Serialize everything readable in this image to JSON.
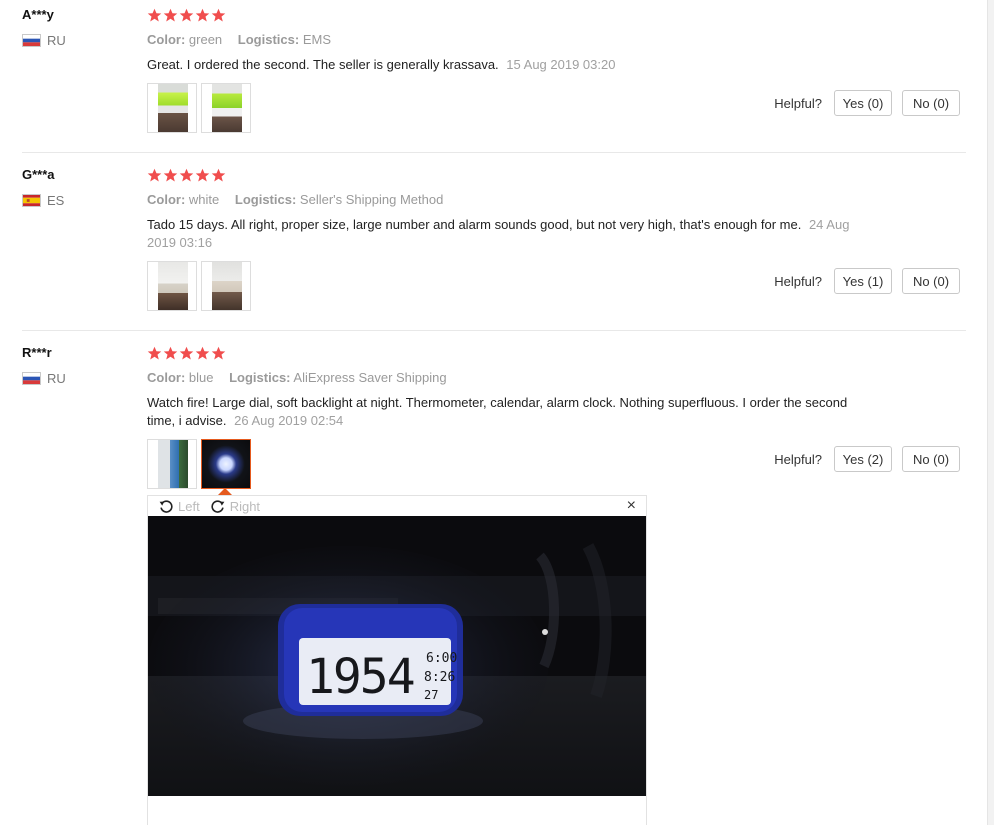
{
  "reviews": [
    {
      "user": "A***y",
      "country": "RU",
      "flag": "ru",
      "rating": 5,
      "color_label": "Color:",
      "color_value": "green",
      "logistics_label": "Logistics:",
      "logistics_value": "EMS",
      "text": "Great. I ordered the second. The seller is generally krassava.",
      "date": "15 Aug 2019 03:20",
      "thumbnails": [
        "photo-thumbnail",
        "photo-thumbnail"
      ],
      "helpful_label": "Helpful?",
      "yes_label": "Yes (0)",
      "no_label": "No (0)"
    },
    {
      "user": "G***a",
      "country": "ES",
      "flag": "es",
      "rating": 5,
      "color_label": "Color:",
      "color_value": "white",
      "logistics_label": "Logistics:",
      "logistics_value": "Seller's Shipping Method",
      "text": "Tado 15 days. All right, proper size, large number and alarm sounds good, but not very high, that's enough for me.",
      "date": "24 Aug 2019 03:16",
      "thumbnails": [
        "photo-thumbnail",
        "photo-thumbnail"
      ],
      "helpful_label": "Helpful?",
      "yes_label": "Yes (1)",
      "no_label": "No (0)"
    },
    {
      "user": "R***r",
      "country": "RU",
      "flag": "ru",
      "rating": 5,
      "color_label": "Color:",
      "color_value": "blue",
      "logistics_label": "Logistics:",
      "logistics_value": "AliExpress Saver Shipping",
      "text": "Watch fire! Large dial, soft backlight at night. Thermometer, calendar, alarm clock. Nothing superfluous. I order the second time, i advise.",
      "date": "26 Aug 2019 02:54",
      "thumbnails": [
        "photo-thumbnail",
        "photo-thumbnail-selected"
      ],
      "helpful_label": "Helpful?",
      "yes_label": "Yes (2)",
      "no_label": "No (0)"
    }
  ],
  "viewer": {
    "rotate_left_label": "Left",
    "rotate_right_label": "Right",
    "close_label": "×",
    "clock_display": "1954",
    "clock_alarm": "6:00",
    "clock_date": "8:26",
    "clock_temp": "27"
  },
  "colors": {
    "star": "#f04d4d",
    "selected_border": "#e55a1e",
    "muted_text": "#999999"
  }
}
